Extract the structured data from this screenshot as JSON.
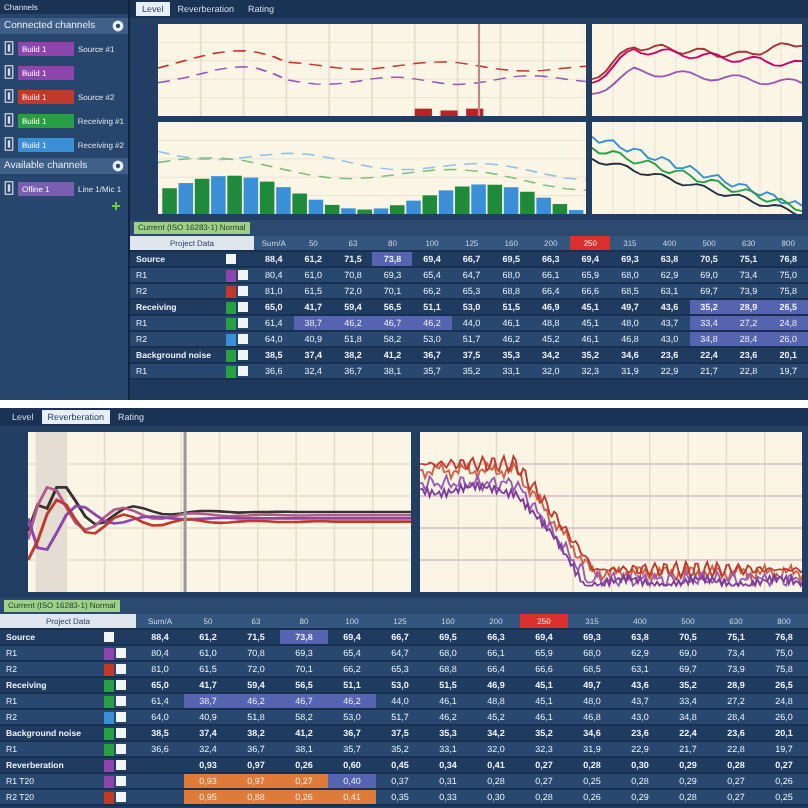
{
  "top": {
    "sidebar": {
      "title": "Channels",
      "sections": [
        {
          "title": "Connected channels",
          "items": [
            {
              "tag": "Build 1",
              "note": "Source #1",
              "color": "#8e44ad"
            },
            {
              "tag": "Build 1",
              "color": "#8e44ad"
            },
            {
              "tag": "Build 1",
              "note": "Source #2",
              "color": "#c0392b"
            },
            {
              "tag": "Build 1",
              "note": "Receiving #1",
              "color": "#27a045"
            },
            {
              "tag": "Build 1",
              "note": "Receiving #2",
              "color": "#3a8fd6"
            }
          ]
        },
        {
          "title": "Available channels",
          "items": [
            {
              "tag": "Ofline 1",
              "note": "Line 1/Mic 1",
              "color": "#7a5fb0"
            }
          ]
        }
      ]
    },
    "tabs": [
      {
        "label": "Level",
        "selected": true
      },
      {
        "label": "Reverberation",
        "selected": false
      },
      {
        "label": "Rating",
        "selected": false
      }
    ],
    "measurement_tab": "Current (ISO 16283-1) Normal",
    "table": {
      "columns": [
        {
          "label": "Project Data",
          "selected": false
        },
        {
          "label": "Sum/A",
          "selected": false
        },
        {
          "label": "50",
          "selected": false
        },
        {
          "label": "63",
          "selected": false
        },
        {
          "label": "80",
          "selected": false
        },
        {
          "label": "100",
          "selected": false
        },
        {
          "label": "125",
          "selected": false
        },
        {
          "label": "160",
          "selected": false
        },
        {
          "label": "200",
          "selected": false
        },
        {
          "label": "250",
          "selected": true
        },
        {
          "label": "315",
          "selected": false
        },
        {
          "label": "400",
          "selected": false
        },
        {
          "label": "500",
          "selected": false
        },
        {
          "label": "630",
          "selected": false
        },
        {
          "label": "800",
          "selected": false
        }
      ],
      "rows": [
        {
          "kind": "group",
          "cells": [
            "Source",
            "88,4",
            "61,2",
            "71,5",
            {
              "text": "73,8",
              "color": "#5563b0"
            },
            "69,4",
            "66,7",
            "69,5",
            "66,3",
            "69,4",
            "69,3",
            "63,8",
            "70,5",
            "75,1",
            "76,8"
          ]
        },
        {
          "kind": "channel",
          "color": "#8e44ad",
          "cells": [
            "R1",
            "80,4",
            "61,0",
            "70,8",
            "69,3",
            "65,4",
            "64,7",
            "68,0",
            "66,1",
            "65,9",
            "68,0",
            "62,9",
            "69,0",
            "73,4",
            "75,0"
          ]
        },
        {
          "kind": "channel",
          "color": "#c0392b",
          "cells": [
            "R2",
            "81,0",
            "61,5",
            "72,0",
            "70,1",
            "66,2",
            "65,3",
            "68,8",
            "66,4",
            "66,6",
            "68,5",
            "63,1",
            "69,7",
            "73,9",
            "75,8"
          ]
        },
        {
          "kind": "group",
          "color": "#27a045",
          "cells": [
            "Receiving",
            "65,0",
            "41,7",
            "59,4",
            "56,5",
            "51,1",
            "53,0",
            "51,5",
            "46,9",
            "45,1",
            "49,7",
            "43,6",
            {
              "text": "35,2",
              "color": "#5563b0"
            },
            {
              "text": "28,9",
              "color": "#5563b0"
            },
            {
              "text": "26,5",
              "color": "#5563b0"
            }
          ]
        },
        {
          "kind": "channel",
          "color": "#27a045",
          "cells": [
            "R1",
            "61,4",
            {
              "text": "38,7",
              "color": "#5563b0"
            },
            {
              "text": "46,2",
              "color": "#5563b0"
            },
            {
              "text": "46,7",
              "color": "#5563b0"
            },
            {
              "text": "46,2",
              "color": "#5563b0"
            },
            "44,0",
            "46,1",
            "48,8",
            "45,1",
            "48,0",
            "43,7",
            {
              "text": "33,4",
              "color": "#5563b0"
            },
            {
              "text": "27,2",
              "color": "#5563b0"
            },
            {
              "text": "24,8",
              "color": "#5563b0"
            }
          ]
        },
        {
          "kind": "channel",
          "color": "#3a8fd6",
          "cells": [
            "R2",
            "64,0",
            "40,9",
            "51,8",
            "58,2",
            "53,0",
            "51,7",
            "46,2",
            "45,2",
            "46,1",
            "46,8",
            "43,0",
            {
              "text": "34,8",
              "color": "#5563b0"
            },
            {
              "text": "28,4",
              "color": "#5563b0"
            },
            {
              "text": "26,0",
              "color": "#5563b0"
            }
          ]
        },
        {
          "kind": "group",
          "color": "#27a045",
          "cells": [
            "Background noise",
            "38,5",
            "37,4",
            "38,2",
            "41,2",
            "36,7",
            "37,5",
            "35,3",
            "34,2",
            "35,2",
            "34,6",
            "23,6",
            "22,4",
            "23,6",
            "20,1"
          ]
        },
        {
          "kind": "channel",
          "color": "#27a045",
          "cells": [
            "R1",
            "36,6",
            "32,4",
            "36,7",
            "38,1",
            "35,7",
            "35,2",
            "33,1",
            "32,0",
            "32,3",
            "31,9",
            "22,9",
            "21,7",
            "22,8",
            "19,7"
          ]
        }
      ]
    }
  },
  "bottom": {
    "tabs": [
      {
        "label": "Level",
        "selected": false
      },
      {
        "label": "Reverberation",
        "selected": true
      },
      {
        "label": "Rating",
        "selected": false
      }
    ],
    "measurement_tab": "Current (ISO 16283-1) Normal",
    "table": {
      "columns": [
        {
          "label": "Project Data",
          "selected": false
        },
        {
          "label": "Sum/A",
          "selected": false
        },
        {
          "label": "50",
          "selected": false
        },
        {
          "label": "63",
          "selected": false
        },
        {
          "label": "80",
          "selected": false
        },
        {
          "label": "100",
          "selected": false
        },
        {
          "label": "125",
          "selected": false
        },
        {
          "label": "160",
          "selected": false
        },
        {
          "label": "200",
          "selected": false
        },
        {
          "label": "250",
          "selected": true
        },
        {
          "label": "315",
          "selected": false
        },
        {
          "label": "400",
          "selected": false
        },
        {
          "label": "500",
          "selected": false
        },
        {
          "label": "630",
          "selected": false
        },
        {
          "label": "800",
          "selected": false
        }
      ],
      "rows": [
        {
          "kind": "group",
          "cells": [
            "Source",
            "88,4",
            "61,2",
            "71,5",
            {
              "text": "73,8",
              "color": "#5563b0"
            },
            "69,4",
            "66,7",
            "69,5",
            "66,3",
            "69,4",
            "69,3",
            "63,8",
            "70,5",
            "75,1",
            "76,8"
          ]
        },
        {
          "kind": "channel",
          "color": "#8e44ad",
          "cells": [
            "R1",
            "80,4",
            "61,0",
            "70,8",
            "69,3",
            "65,4",
            "64,7",
            "68,0",
            "66,1",
            "65,9",
            "68,0",
            "62,9",
            "69,0",
            "73,4",
            "75,0"
          ]
        },
        {
          "kind": "channel",
          "color": "#c0392b",
          "cells": [
            "R2",
            "81,0",
            "61,5",
            "72,0",
            "70,1",
            "66,2",
            "65,3",
            "68,8",
            "66,4",
            "66,6",
            "68,5",
            "63,1",
            "69,7",
            "73,9",
            "75,8"
          ]
        },
        {
          "kind": "group",
          "color": "#27a045",
          "cells": [
            "Receiving",
            "65,0",
            "41,7",
            "59,4",
            "56,5",
            "51,1",
            "53,0",
            "51,5",
            "46,9",
            "45,1",
            "49,7",
            "43,6",
            "35,2",
            "28,9",
            "26,5"
          ]
        },
        {
          "kind": "channel",
          "color": "#27a045",
          "cells": [
            "R1",
            "61,4",
            {
              "text": "38,7",
              "color": "#5563b0"
            },
            {
              "text": "46,2",
              "color": "#5563b0"
            },
            {
              "text": "46,7",
              "color": "#5563b0"
            },
            {
              "text": "46,2",
              "color": "#5563b0"
            },
            "44,0",
            "46,1",
            "48,8",
            "45,1",
            "48,0",
            "43,7",
            "33,4",
            "27,2",
            "24,8"
          ]
        },
        {
          "kind": "channel",
          "color": "#3a8fd6",
          "cells": [
            "R2",
            "64,0",
            "40,9",
            "51,8",
            "58,2",
            "53,0",
            "51,7",
            "46,2",
            "45,2",
            "46,1",
            "46,8",
            "43,0",
            "34,8",
            "28,4",
            "26,0"
          ]
        },
        {
          "kind": "group",
          "color": "#27a045",
          "cells": [
            "Background noise",
            "38,5",
            "37,4",
            "38,2",
            "41,2",
            "36,7",
            "37,5",
            "35,3",
            "34,2",
            "35,2",
            "34,6",
            "23,6",
            "22,4",
            "23,6",
            "20,1"
          ]
        },
        {
          "kind": "channel",
          "color": "#27a045",
          "cells": [
            "R1",
            "36,6",
            "32,4",
            "36,7",
            "38,1",
            "35,7",
            "35,2",
            "33,1",
            "32,0",
            "32,3",
            "31,9",
            "22,9",
            "21,7",
            "22,8",
            "19,7"
          ]
        },
        {
          "kind": "group",
          "color": "#8e44ad",
          "cells": [
            "Reverberation",
            "",
            "0,93",
            "0,97",
            "0,26",
            "0,60",
            "0,45",
            "0,34",
            "0,41",
            "0,27",
            "0,28",
            "0,30",
            "0,29",
            "0,28",
            "0,27"
          ]
        },
        {
          "kind": "channel",
          "color": "#8e44ad",
          "cells": [
            "R1 T20",
            "",
            {
              "text": "0,93",
              "color": "#e07a38"
            },
            {
              "text": "0,97",
              "color": "#e07a38"
            },
            {
              "text": "0,27",
              "color": "#e07a38"
            },
            {
              "text": "0,40",
              "color": "#5563b0"
            },
            "0,37",
            "0,31",
            "0,28",
            "0,27",
            "0,25",
            "0,28",
            "0,29",
            "0,27",
            "0,26"
          ]
        },
        {
          "kind": "channel",
          "color": "#c0392b",
          "cells": [
            "R2 T20",
            "",
            {
              "text": "0,95",
              "color": "#e07a38"
            },
            {
              "text": "0,88",
              "color": "#e07a38"
            },
            {
              "text": "0,26",
              "color": "#e07a38"
            },
            {
              "text": "0,41",
              "color": "#e07a38"
            },
            "0,35",
            "0,33",
            "0,30",
            "0,28",
            "0,26",
            "0,29",
            "0,28",
            "0,27",
            "0,25"
          ]
        }
      ]
    }
  }
}
